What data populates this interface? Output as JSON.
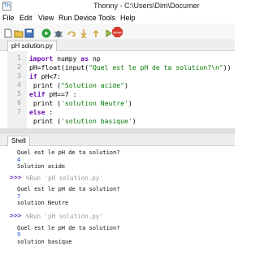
{
  "window": {
    "title": "Thonny  -  C:\\Users\\Dim\\Documer"
  },
  "menu": [
    "File",
    "Edit",
    "View",
    "Run",
    "Device",
    "Tools",
    "Help"
  ],
  "toolbar": {
    "icons": [
      "new-file-icon",
      "open-file-icon",
      "save-icon",
      "run-icon",
      "debug-icon",
      "step-over-icon",
      "step-into-icon",
      "step-out-icon",
      "resume-icon",
      "stop-icon"
    ],
    "stop_label": "STOP",
    "colors": {
      "run": "#2e9e3e",
      "stop": "#d63a2f"
    }
  },
  "editor": {
    "tab": "pH solution.py",
    "line_numbers": [
      "1",
      "2",
      "3",
      "4",
      "5",
      "6",
      "7"
    ],
    "lines": [
      [
        "import",
        " numpy ",
        "as",
        " np"
      ],
      [
        "pH=float(input(",
        "\"Quel est le pH de ta solution?\\n\"",
        "))"
      ],
      [
        "if",
        " pH<7:"
      ],
      [
        " print (",
        "\"Solution acide\"",
        ")"
      ],
      [
        "elif",
        " pH==7 :"
      ],
      [
        " print (",
        "'solution Neutre'",
        ")"
      ],
      [
        "else",
        " :"
      ],
      [
        " print (",
        "'solution basique'",
        ")"
      ]
    ]
  },
  "shell": {
    "tab": "Shell",
    "prompt": ">>>",
    "run_cmd": "%Run 'pH solution.py'",
    "blocks": [
      {
        "q": "Quel est le pH de ta solution?",
        "input": "4",
        "result": "Solution acide"
      },
      {
        "q": "Quel est le pH de ta solution?",
        "input": "7",
        "result": "solution Neutre"
      },
      {
        "q": "Quel est le pH de ta solution?",
        "input": "9",
        "result": "solution basique"
      }
    ]
  }
}
